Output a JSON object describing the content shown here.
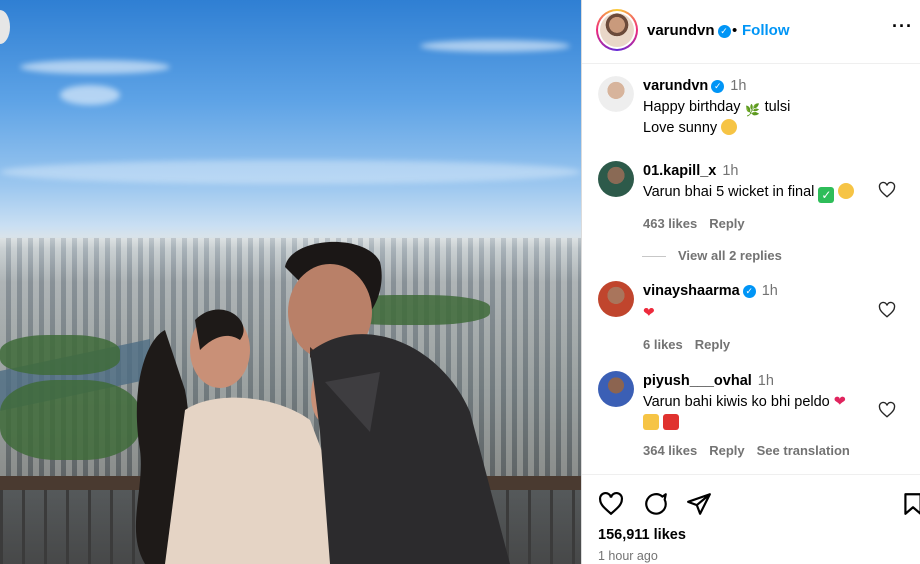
{
  "post": {
    "author": "varundvn",
    "follow_label": "Follow",
    "dot": "•",
    "more": "···",
    "likes": "156,911 likes",
    "time_ago": "1 hour ago"
  },
  "caption": {
    "user": "varundvn",
    "time": "1h",
    "line1": "Happy birthday",
    "line1b": "tulsi",
    "line2": "Love sunny"
  },
  "comments": [
    {
      "user": "01.kapill_x",
      "time": "1h",
      "text": "Varun bhai 5 wicket in final",
      "likes": "463 likes",
      "reply": "Reply"
    },
    {
      "user": "vinayshaarma",
      "time": "1h",
      "text": "",
      "likes": "6 likes",
      "reply": "Reply"
    },
    {
      "user": "piyush___ovhal",
      "time": "1h",
      "text": "Varun bahi kiwis ko bhi peldo",
      "likes": "364 likes",
      "reply": "Reply",
      "translation": "See translation"
    }
  ],
  "view_replies": "View all 2 replies",
  "colors": {
    "accent": "#0095f6",
    "muted": "#737373"
  },
  "icons": [
    "verified-icon",
    "more-icon",
    "heart-icon",
    "comment-icon",
    "share-icon",
    "bookmark-icon"
  ]
}
